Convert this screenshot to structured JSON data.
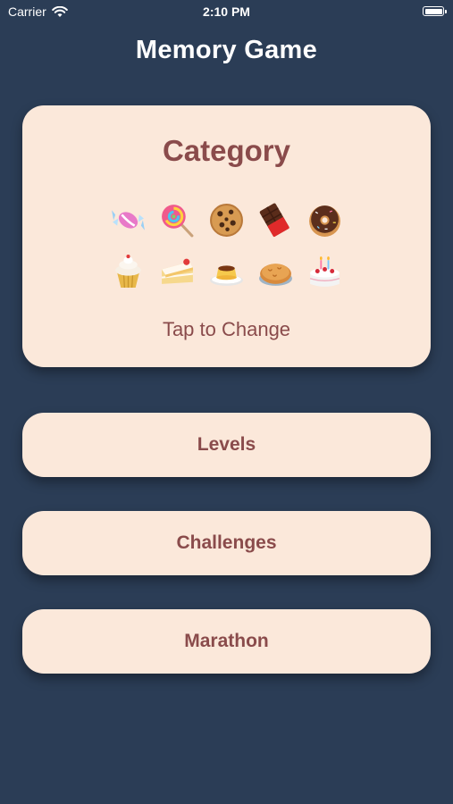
{
  "status_bar": {
    "carrier": "Carrier",
    "time": "2:10 PM"
  },
  "header": {
    "title": "Memory Game"
  },
  "category": {
    "title": "Category",
    "tap_label": "Tap to Change",
    "icons_row1": [
      "candy-icon",
      "lollipop-icon",
      "cookie-icon",
      "chocolate-bar-icon",
      "donut-icon"
    ],
    "icons_row2": [
      "cupcake-icon",
      "cake-slice-icon",
      "custard-icon",
      "pie-icon",
      "birthday-cake-icon"
    ]
  },
  "menu": {
    "levels": "Levels",
    "challenges": "Challenges",
    "marathon": "Marathon"
  },
  "colors": {
    "background": "#2b3d56",
    "card": "#fbe8da",
    "accent_text": "#8a4b4b"
  }
}
